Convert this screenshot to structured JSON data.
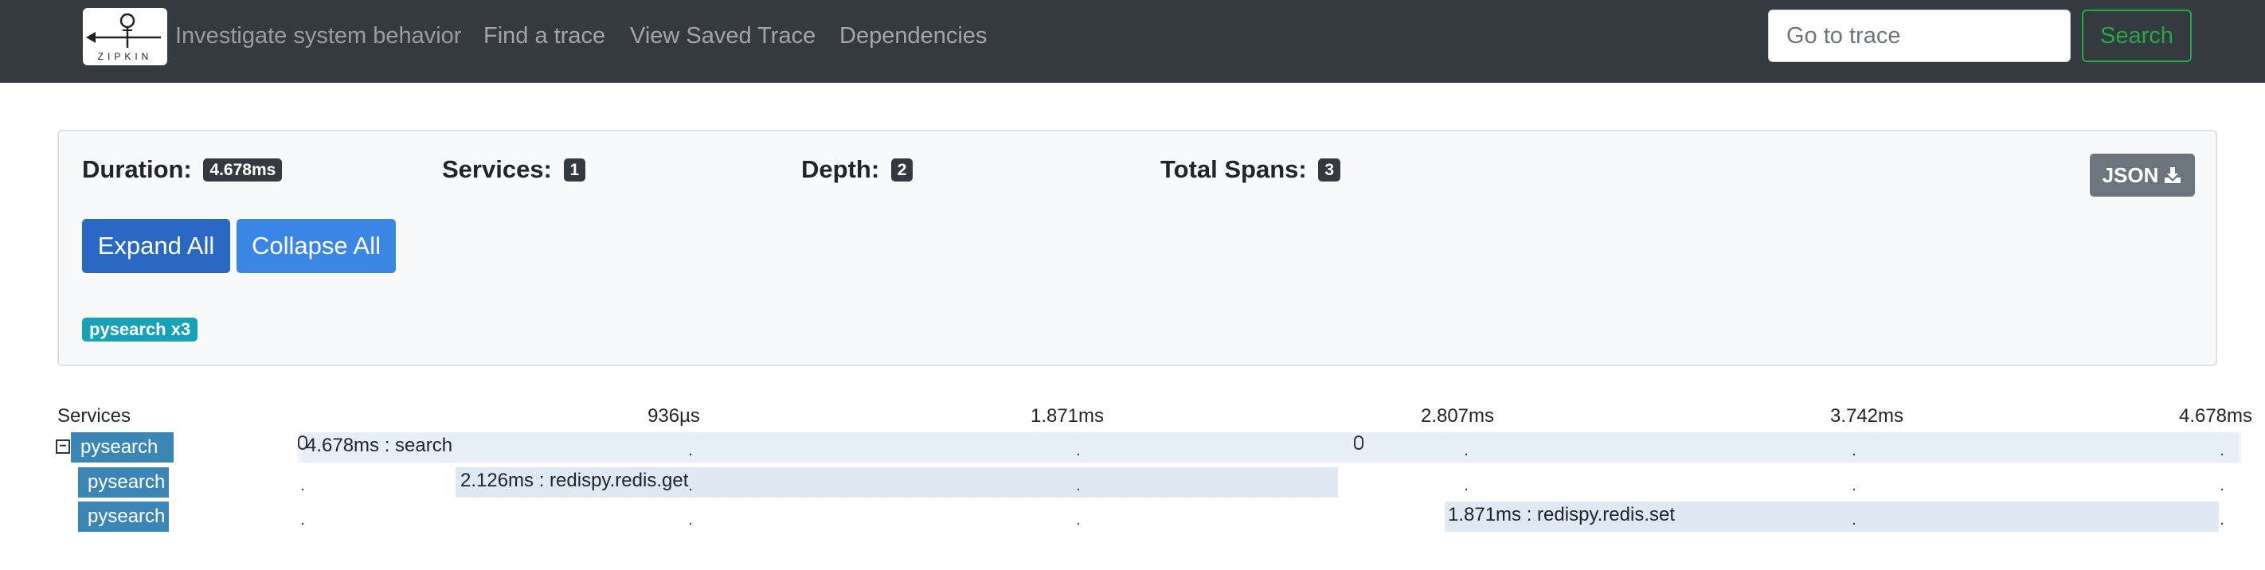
{
  "navbar": {
    "brand": "ZIPKIN",
    "tagline": "Investigate system behavior",
    "links": [
      "Find a trace",
      "View Saved Trace",
      "Dependencies"
    ],
    "search_placeholder": "Go to trace",
    "search_button": "Search",
    "colors": {
      "background": "#343a40",
      "search_button": "#28a745"
    }
  },
  "summary": {
    "duration_label": "Duration:",
    "duration": "4.678ms",
    "services_label": "Services:",
    "services": "1",
    "depth_label": "Depth:",
    "depth": "2",
    "total_spans_label": "Total Spans:",
    "total_spans": "3",
    "json_button": "JSON",
    "json_icon": "download-icon",
    "expand_all": "Expand All",
    "collapse_all": "Collapse All",
    "service_badge": "pysearch x3"
  },
  "timeline": {
    "services_header": "Services",
    "ticks": [
      "936µs",
      "1.871ms",
      "2.807ms",
      "3.742ms",
      "4.678ms"
    ],
    "spans": [
      {
        "service": "pysearch",
        "label": "4.678ms : search",
        "start_ms": 0,
        "duration_ms": 4.678,
        "depth": 0,
        "collapsible": true,
        "collapse_symbol": "−"
      },
      {
        "service": "pysearch",
        "label": "2.126ms : redispy.redis.get",
        "start_ms": 0.41,
        "duration_ms": 2.126,
        "depth": 1,
        "collapsible": false
      },
      {
        "service": "pysearch",
        "label": "1.871ms : redispy.redis.set",
        "start_ms": 2.78,
        "duration_ms": 1.871,
        "depth": 1,
        "collapsible": false
      }
    ]
  }
}
